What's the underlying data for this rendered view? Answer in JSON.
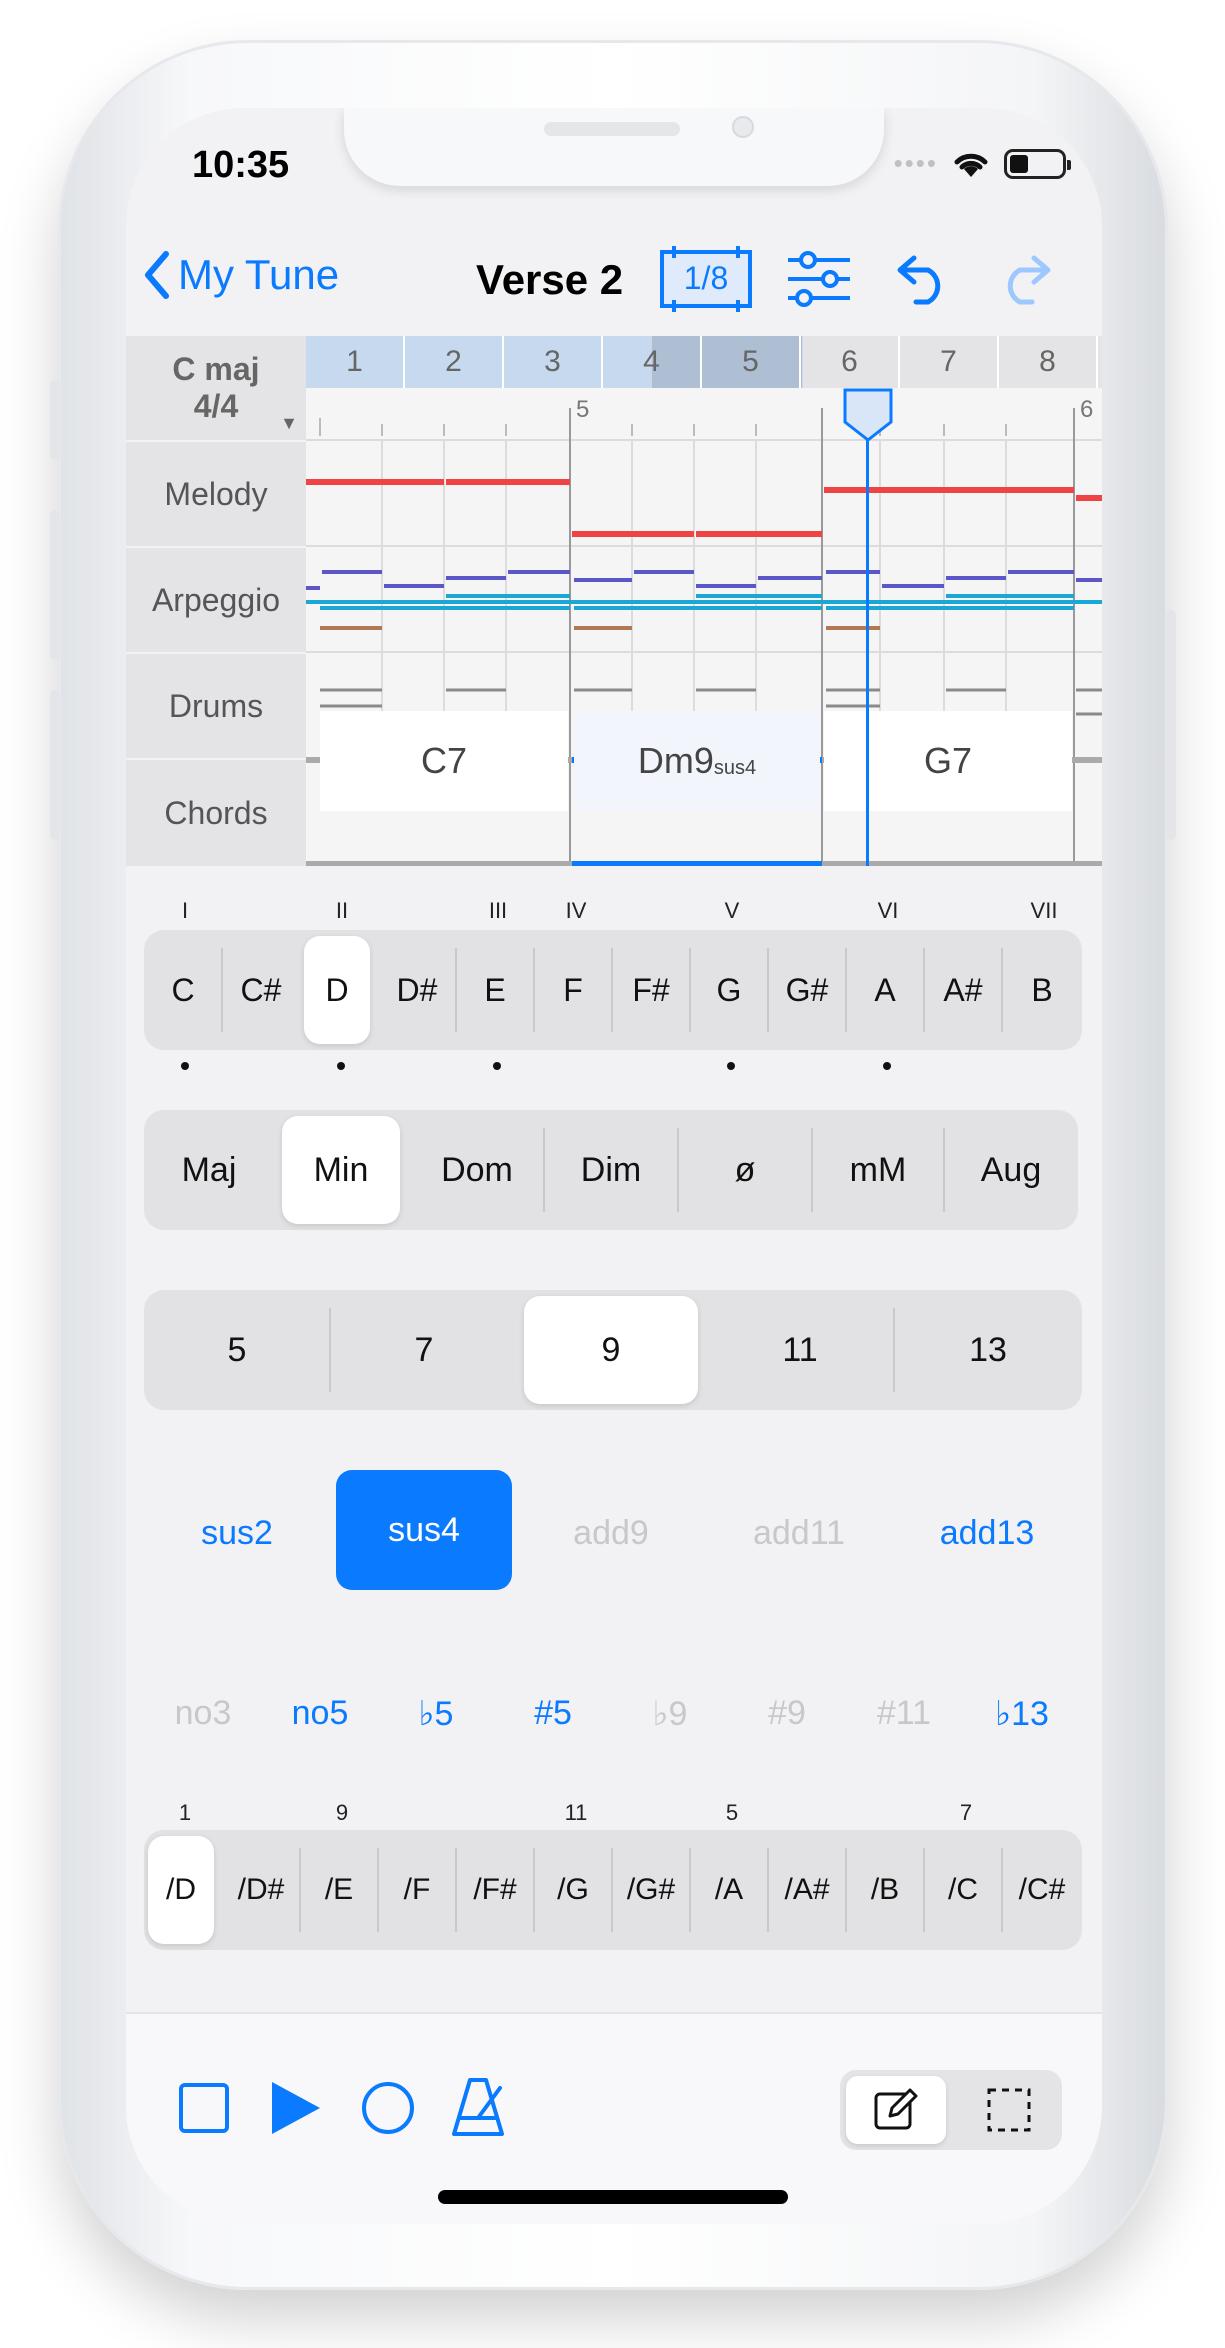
{
  "status": {
    "time": "10:35"
  },
  "nav": {
    "back_label": "My Tune",
    "title": "Verse 2",
    "quantize": "1/8"
  },
  "header": {
    "key": "C maj",
    "time_signature": "4/4"
  },
  "bars": [
    "1",
    "2",
    "3",
    "4",
    "5",
    "6",
    "7",
    "8"
  ],
  "ruler": {
    "marker_left": "5",
    "marker_right": "6"
  },
  "tracks": [
    "Melody",
    "Arpeggio",
    "Drums",
    "Chords"
  ],
  "chords": [
    {
      "name": "C7",
      "suffix": ""
    },
    {
      "name": "Dm9",
      "suffix": "sus4"
    },
    {
      "name": "G7",
      "suffix": ""
    }
  ],
  "roots": {
    "degrees": [
      "I",
      "",
      "II",
      "",
      "III",
      "IV",
      "",
      "V",
      "",
      "VI",
      "",
      "VII"
    ],
    "notes": [
      "C",
      "C#",
      "D",
      "D#",
      "E",
      "F",
      "F#",
      "G",
      "G#",
      "A",
      "A#",
      "B"
    ],
    "selected": "D",
    "dots": [
      true,
      false,
      true,
      false,
      true,
      false,
      false,
      true,
      false,
      true,
      false,
      false
    ]
  },
  "qualities": {
    "items": [
      "Maj",
      "Min",
      "Dom",
      "Dim",
      "ø",
      "mM",
      "Aug"
    ],
    "selected": "Min"
  },
  "extensions": {
    "items": [
      "5",
      "7",
      "9",
      "11",
      "13"
    ],
    "selected": "9"
  },
  "sus_add": {
    "items": [
      "sus2",
      "sus4",
      "add9",
      "add11",
      "add13"
    ],
    "selected": "sus4",
    "disabled": [
      "add9",
      "add11"
    ]
  },
  "alterations": {
    "items": [
      "no3",
      "no5",
      "♭5",
      "#5",
      "♭9",
      "#9",
      "#11",
      "♭13"
    ],
    "disabled": [
      "no3",
      "♭9",
      "#9",
      "#11"
    ]
  },
  "bass": {
    "intervals": [
      "1",
      "",
      "9",
      "",
      "",
      "11",
      "",
      "5",
      "",
      "",
      "7",
      ""
    ],
    "notes": [
      "/D",
      "/D#",
      "/E",
      "/F",
      "/F#",
      "/G",
      "/G#",
      "/A",
      "/A#",
      "/B",
      "/C",
      "/C#"
    ],
    "selected": "/D"
  },
  "colors": {
    "accent": "#0a7aff",
    "melody": "#ef4444",
    "arp_purple": "#5b57c9",
    "arp_cyan": "#1aa7d6",
    "drum_brown": "#b07855",
    "drum_gray": "#8a8a8a"
  }
}
